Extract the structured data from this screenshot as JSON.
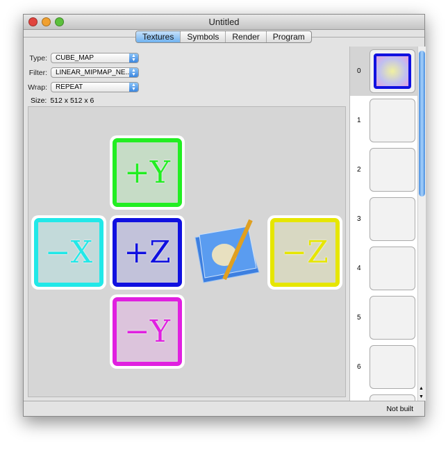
{
  "window": {
    "title": "Untitled"
  },
  "tabs": [
    {
      "label": "Textures",
      "selected": true
    },
    {
      "label": "Symbols"
    },
    {
      "label": "Render"
    },
    {
      "label": "Program"
    }
  ],
  "fields": {
    "type": {
      "label": "Type:",
      "value": "CUBE_MAP"
    },
    "filter": {
      "label": "Filter:",
      "value": "LINEAR_MIPMAP_NE..."
    },
    "wrap": {
      "label": "Wrap:",
      "value": "REPEAT"
    },
    "size": {
      "label": "Size:",
      "value": "512 x 512 x 6"
    }
  },
  "faces": {
    "py": "+Y",
    "nx": "−X",
    "pz": "+Z",
    "nz": "−Z",
    "ny": "−Y"
  },
  "colors": {
    "py": "#22ee22",
    "nx": "#22e8e8",
    "pz": "#1010e0",
    "nz": "#e6e600",
    "ny": "#e020e0"
  },
  "textures": [
    "0",
    "1",
    "2",
    "3",
    "4",
    "5",
    "6"
  ],
  "status": "Not built"
}
